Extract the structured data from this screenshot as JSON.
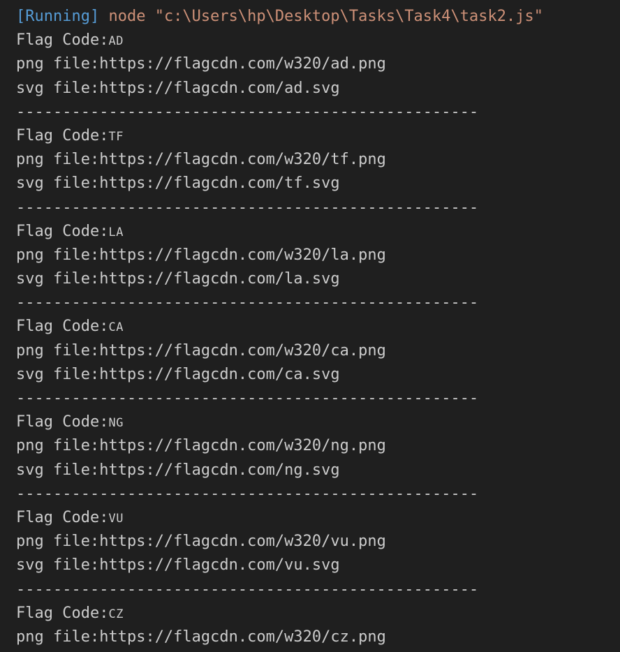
{
  "output": {
    "running_label": "[Running]",
    "command": "node \"c:\\Users\\hp\\Desktop\\Tasks\\Task4\\task2.js\"",
    "flag_code_label": "Flag Code:",
    "png_label": "png file:",
    "svg_label": "svg file:",
    "separator": "--------------------------------------------------",
    "entries": [
      {
        "code": "AD",
        "png": "https://flagcdn.com/w320/ad.png",
        "svg": "https://flagcdn.com/ad.svg"
      },
      {
        "code": "TF",
        "png": "https://flagcdn.com/w320/tf.png",
        "svg": "https://flagcdn.com/tf.svg"
      },
      {
        "code": "LA",
        "png": "https://flagcdn.com/w320/la.png",
        "svg": "https://flagcdn.com/la.svg"
      },
      {
        "code": "CA",
        "png": "https://flagcdn.com/w320/ca.png",
        "svg": "https://flagcdn.com/ca.svg"
      },
      {
        "code": "NG",
        "png": "https://flagcdn.com/w320/ng.png",
        "svg": "https://flagcdn.com/ng.svg"
      },
      {
        "code": "VU",
        "png": "https://flagcdn.com/w320/vu.png",
        "svg": "https://flagcdn.com/vu.svg"
      },
      {
        "code": "CZ",
        "png": "https://flagcdn.com/w320/cz.png"
      }
    ]
  },
  "colors": {
    "background": "#1f1f1f",
    "text": "#cccccc",
    "running": "#569cd6",
    "command": "#ce9178"
  }
}
